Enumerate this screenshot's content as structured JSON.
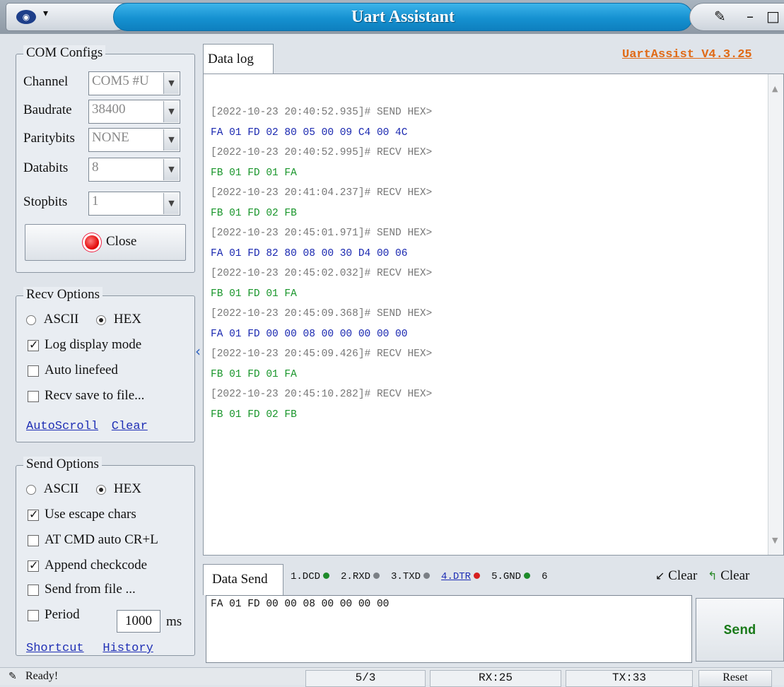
{
  "window": {
    "title": "Uart Assistant",
    "version": "UartAssist V4.3.25"
  },
  "com": {
    "legend": "COM Configs",
    "fields": [
      {
        "label": "Channel",
        "value": "COM5 #U"
      },
      {
        "label": "Baudrate",
        "value": "38400"
      },
      {
        "label": "Paritybits",
        "value": "NONE"
      },
      {
        "label": "Databits",
        "value": "8"
      },
      {
        "label": "Stopbits",
        "value": "1"
      }
    ],
    "close_label": "Close"
  },
  "recv": {
    "legend": "Recv Options",
    "ascii": "ASCII",
    "hex": "HEX",
    "opts": [
      "Log display mode",
      "Auto linefeed",
      "Recv save to file..."
    ],
    "checked": [
      true,
      false,
      false
    ],
    "autoscroll": "AutoScroll",
    "clear": "Clear"
  },
  "send_opts": {
    "legend": "Send Options",
    "ascii": "ASCII",
    "hex": "HEX",
    "opts": [
      "Use escape chars",
      "AT CMD auto CR+L",
      "Append checkcode",
      "Send from file ..."
    ],
    "checked": [
      true,
      false,
      true,
      false
    ],
    "period_label": "Period",
    "period_value": "1000",
    "period_unit": "ms",
    "shortcut": "Shortcut",
    "history": "History"
  },
  "log": {
    "tab": "Data log",
    "lines": [
      {
        "kind": "ts",
        "text": "[2022-10-23 20:40:52.935]# SEND HEX>"
      },
      {
        "kind": "send",
        "text": "FA 01 FD 02 80 05 00 09 C4 00 4C"
      },
      {
        "kind": "ts",
        "text": "[2022-10-23 20:40:52.995]# RECV HEX>"
      },
      {
        "kind": "recv",
        "text": "FB 01 FD 01 FA"
      },
      {
        "kind": "ts",
        "text": "[2022-10-23 20:41:04.237]# RECV HEX>"
      },
      {
        "kind": "recv",
        "text": "FB 01 FD 02 FB"
      },
      {
        "kind": "ts",
        "text": "[2022-10-23 20:45:01.971]# SEND HEX>"
      },
      {
        "kind": "send",
        "text": "FA 01 FD 82 80 08 00 30 D4 00 06"
      },
      {
        "kind": "ts",
        "text": "[2022-10-23 20:45:02.032]# RECV HEX>"
      },
      {
        "kind": "recv",
        "text": "FB 01 FD 01 FA"
      },
      {
        "kind": "ts",
        "text": "[2022-10-23 20:45:09.368]# SEND HEX>"
      },
      {
        "kind": "send",
        "text": "FA 01 FD 00 00 08 00 00 00 00 00"
      },
      {
        "kind": "ts",
        "text": "[2022-10-23 20:45:09.426]# RECV HEX>"
      },
      {
        "kind": "recv",
        "text": "FB 01 FD 01 FA"
      },
      {
        "kind": "ts",
        "text": "[2022-10-23 20:45:10.282]# RECV HEX>"
      },
      {
        "kind": "recv",
        "text": "FB 01 FD 02 FB"
      }
    ]
  },
  "send": {
    "tab": "Data Send",
    "pins": [
      {
        "label": "1.DCD",
        "color": "#1d8a2a"
      },
      {
        "label": "2.RXD",
        "color": "#7a7f85"
      },
      {
        "label": "3.TXD",
        "color": "#7a7f85"
      },
      {
        "label": "4.DTR",
        "color": "#d62020"
      },
      {
        "label": "5.GND",
        "color": "#1d8a2a"
      },
      {
        "label": "6",
        "color": ""
      }
    ],
    "clear1": "Clear",
    "clear2": "Clear",
    "input": "FA 01 FD 00 00 08 00 00 00 00",
    "send_label": "Send"
  },
  "status": {
    "ready": "Ready!",
    "count": "5/3",
    "rx": "RX:25",
    "tx": "TX:33",
    "reset": "Reset"
  }
}
